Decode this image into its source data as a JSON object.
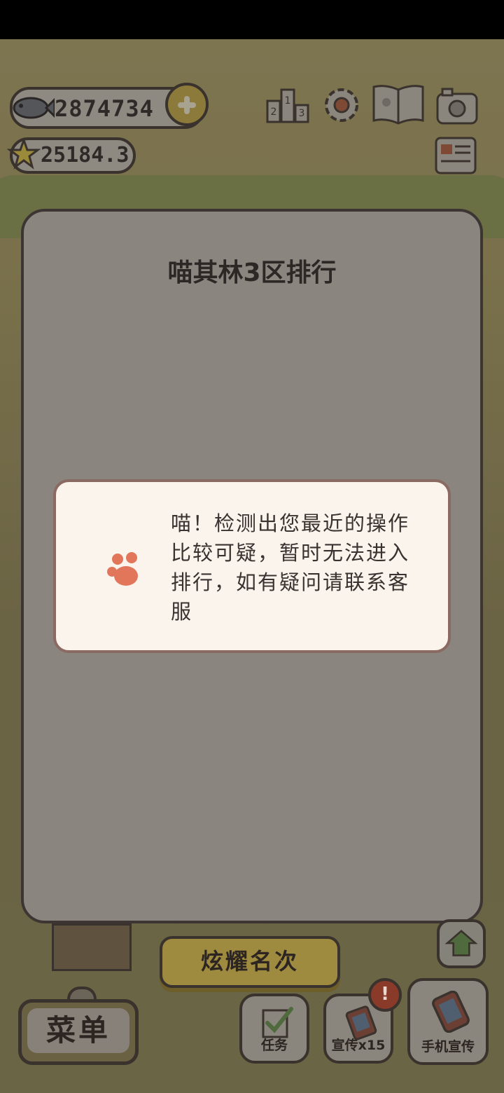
{
  "currency": {
    "fish": "2874734",
    "stars": "25184.3"
  },
  "dialog": {
    "title": "喵其林3区排行",
    "alert_lines": [
      "喵！检测出您最近的操作",
      "比较可疑，暂时无法进入",
      "排行，如有疑问请联系客",
      "服"
    ]
  },
  "buttons": {
    "show_rank": "炫耀名次",
    "menu": "菜单",
    "task": "任务",
    "promo": "宣传x15",
    "phone_promo": "手机宣传",
    "badge": "!"
  },
  "icons": [
    "fish-icon",
    "plus-icon",
    "star-icon",
    "rank-icon",
    "gear-icon",
    "book-icon",
    "camera-icon",
    "news-icon",
    "paw-icon",
    "home-icon"
  ],
  "colors": {
    "accent_paw": "#e2765b",
    "dialog_bg": "#8a867f",
    "alert_bg": "#fbf4ec"
  }
}
